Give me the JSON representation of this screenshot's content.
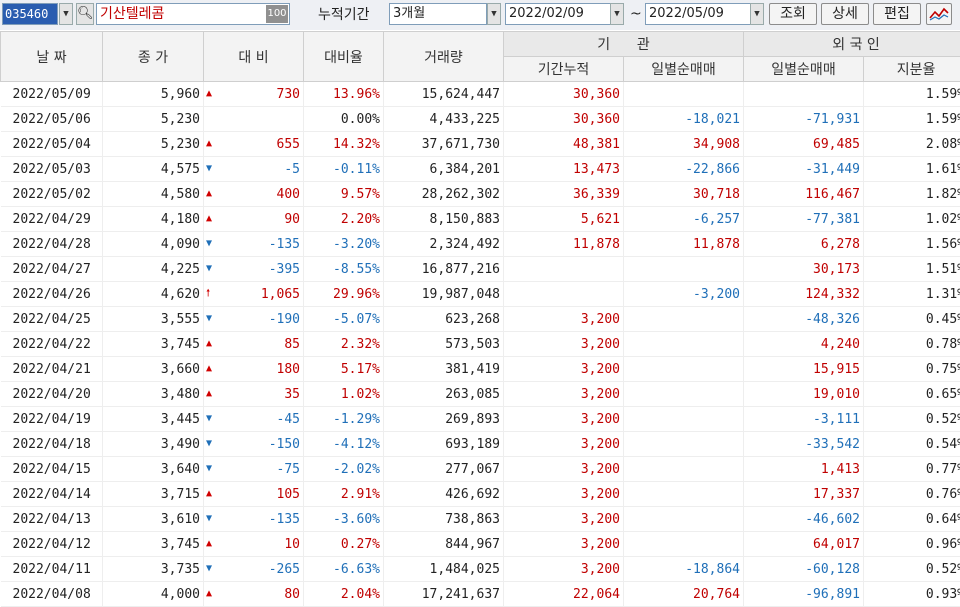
{
  "toolbar": {
    "code": "035460",
    "name": "기산텔레콤",
    "name_tag": "100",
    "period_label": "누적기간",
    "period_value": "3개월",
    "start_date": "2022/02/09",
    "tilde": "~",
    "end_date": "2022/05/09",
    "query_button": "조회",
    "detail_button": "상세",
    "edit_button": "편집"
  },
  "columns": {
    "date": "날 짜",
    "close": "종 가",
    "change": "대 비",
    "rate": "대비율",
    "volume": "거래량",
    "inst_group": "기      관",
    "inst_cum": "기간누적",
    "inst_daily": "일별순매매",
    "foreign_group": "외 국 인",
    "foreign_daily": "일별순매매",
    "foreign_share": "지분율"
  },
  "rows": [
    {
      "date": "2022/05/09",
      "close": "5,960",
      "dir": "up",
      "arrow": "▲",
      "change": "730",
      "rate": "13.96%",
      "volume": "15,624,447",
      "inst_cum": "30,360",
      "inst_daily": "",
      "foreign_daily": "",
      "foreign_share": "1.59%"
    },
    {
      "date": "2022/05/06",
      "close": "5,230",
      "dir": "none",
      "arrow": "",
      "change": "",
      "rate": "0.00%",
      "volume": "4,433,225",
      "inst_cum": "30,360",
      "inst_daily": "-18,021",
      "foreign_daily": "-71,931",
      "foreign_share": "1.59%"
    },
    {
      "date": "2022/05/04",
      "close": "5,230",
      "dir": "up",
      "arrow": "▲",
      "change": "655",
      "rate": "14.32%",
      "volume": "37,671,730",
      "inst_cum": "48,381",
      "inst_daily": "34,908",
      "foreign_daily": "69,485",
      "foreign_share": "2.08%"
    },
    {
      "date": "2022/05/03",
      "close": "4,575",
      "dir": "down",
      "arrow": "▼",
      "change": "-5",
      "rate": "-0.11%",
      "volume": "6,384,201",
      "inst_cum": "13,473",
      "inst_daily": "-22,866",
      "foreign_daily": "-31,449",
      "foreign_share": "1.61%"
    },
    {
      "date": "2022/05/02",
      "close": "4,580",
      "dir": "up",
      "arrow": "▲",
      "change": "400",
      "rate": "9.57%",
      "volume": "28,262,302",
      "inst_cum": "36,339",
      "inst_daily": "30,718",
      "foreign_daily": "116,467",
      "foreign_share": "1.82%"
    },
    {
      "date": "2022/04/29",
      "close": "4,180",
      "dir": "up",
      "arrow": "▲",
      "change": "90",
      "rate": "2.20%",
      "volume": "8,150,883",
      "inst_cum": "5,621",
      "inst_daily": "-6,257",
      "foreign_daily": "-77,381",
      "foreign_share": "1.02%"
    },
    {
      "date": "2022/04/28",
      "close": "4,090",
      "dir": "down",
      "arrow": "▼",
      "change": "-135",
      "rate": "-3.20%",
      "volume": "2,324,492",
      "inst_cum": "11,878",
      "inst_daily": "11,878",
      "foreign_daily": "6,278",
      "foreign_share": "1.56%"
    },
    {
      "date": "2022/04/27",
      "close": "4,225",
      "dir": "down",
      "arrow": "▼",
      "change": "-395",
      "rate": "-8.55%",
      "volume": "16,877,216",
      "inst_cum": "",
      "inst_daily": "",
      "foreign_daily": "30,173",
      "foreign_share": "1.51%"
    },
    {
      "date": "2022/04/26",
      "close": "4,620",
      "dir": "up",
      "arrow": "🠕",
      "change": "1,065",
      "rate": "29.96%",
      "volume": "19,987,048",
      "inst_cum": "",
      "inst_daily": "-3,200",
      "foreign_daily": "124,332",
      "foreign_share": "1.31%"
    },
    {
      "date": "2022/04/25",
      "close": "3,555",
      "dir": "down",
      "arrow": "▼",
      "change": "-190",
      "rate": "-5.07%",
      "volume": "623,268",
      "inst_cum": "3,200",
      "inst_daily": "",
      "foreign_daily": "-48,326",
      "foreign_share": "0.45%"
    },
    {
      "date": "2022/04/22",
      "close": "3,745",
      "dir": "up",
      "arrow": "▲",
      "change": "85",
      "rate": "2.32%",
      "volume": "573,503",
      "inst_cum": "3,200",
      "inst_daily": "",
      "foreign_daily": "4,240",
      "foreign_share": "0.78%"
    },
    {
      "date": "2022/04/21",
      "close": "3,660",
      "dir": "up",
      "arrow": "▲",
      "change": "180",
      "rate": "5.17%",
      "volume": "381,419",
      "inst_cum": "3,200",
      "inst_daily": "",
      "foreign_daily": "15,915",
      "foreign_share": "0.75%"
    },
    {
      "date": "2022/04/20",
      "close": "3,480",
      "dir": "up",
      "arrow": "▲",
      "change": "35",
      "rate": "1.02%",
      "volume": "263,085",
      "inst_cum": "3,200",
      "inst_daily": "",
      "foreign_daily": "19,010",
      "foreign_share": "0.65%"
    },
    {
      "date": "2022/04/19",
      "close": "3,445",
      "dir": "down",
      "arrow": "▼",
      "change": "-45",
      "rate": "-1.29%",
      "volume": "269,893",
      "inst_cum": "3,200",
      "inst_daily": "",
      "foreign_daily": "-3,111",
      "foreign_share": "0.52%"
    },
    {
      "date": "2022/04/18",
      "close": "3,490",
      "dir": "down",
      "arrow": "▼",
      "change": "-150",
      "rate": "-4.12%",
      "volume": "693,189",
      "inst_cum": "3,200",
      "inst_daily": "",
      "foreign_daily": "-33,542",
      "foreign_share": "0.54%"
    },
    {
      "date": "2022/04/15",
      "close": "3,640",
      "dir": "down",
      "arrow": "▼",
      "change": "-75",
      "rate": "-2.02%",
      "volume": "277,067",
      "inst_cum": "3,200",
      "inst_daily": "",
      "foreign_daily": "1,413",
      "foreign_share": "0.77%"
    },
    {
      "date": "2022/04/14",
      "close": "3,715",
      "dir": "up",
      "arrow": "▲",
      "change": "105",
      "rate": "2.91%",
      "volume": "426,692",
      "inst_cum": "3,200",
      "inst_daily": "",
      "foreign_daily": "17,337",
      "foreign_share": "0.76%"
    },
    {
      "date": "2022/04/13",
      "close": "3,610",
      "dir": "down",
      "arrow": "▼",
      "change": "-135",
      "rate": "-3.60%",
      "volume": "738,863",
      "inst_cum": "3,200",
      "inst_daily": "",
      "foreign_daily": "-46,602",
      "foreign_share": "0.64%"
    },
    {
      "date": "2022/04/12",
      "close": "3,745",
      "dir": "up",
      "arrow": "▲",
      "change": "10",
      "rate": "0.27%",
      "volume": "844,967",
      "inst_cum": "3,200",
      "inst_daily": "",
      "foreign_daily": "64,017",
      "foreign_share": "0.96%"
    },
    {
      "date": "2022/04/11",
      "close": "3,735",
      "dir": "down",
      "arrow": "▼",
      "change": "-265",
      "rate": "-6.63%",
      "volume": "1,484,025",
      "inst_cum": "3,200",
      "inst_daily": "-18,864",
      "foreign_daily": "-60,128",
      "foreign_share": "0.52%"
    },
    {
      "date": "2022/04/08",
      "close": "4,000",
      "dir": "up",
      "arrow": "▲",
      "change": "80",
      "rate": "2.04%",
      "volume": "17,241,637",
      "inst_cum": "22,064",
      "inst_daily": "20,764",
      "foreign_daily": "-96,891",
      "foreign_share": "0.93%"
    }
  ]
}
